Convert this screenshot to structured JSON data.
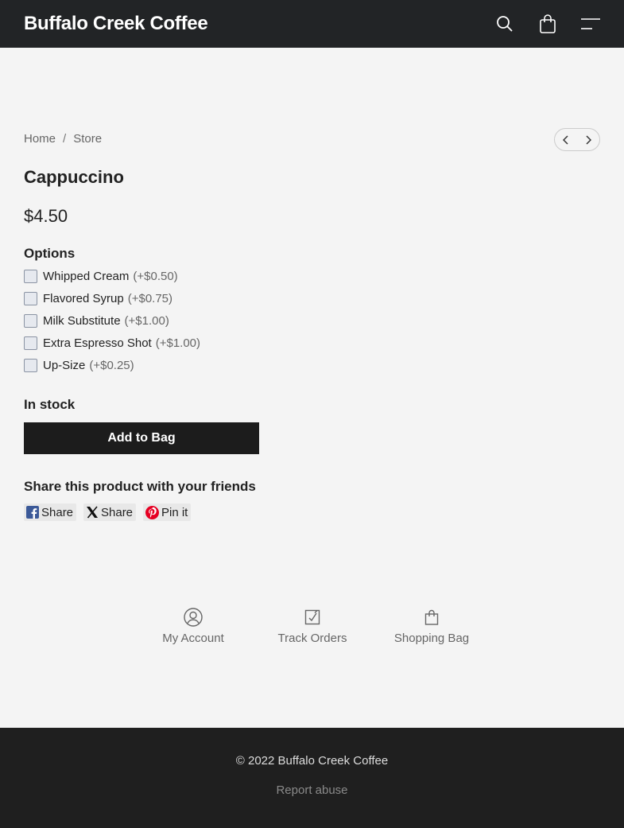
{
  "header": {
    "brand": "Buffalo Creek Coffee",
    "icons": [
      "search-icon",
      "shopping-bag-icon",
      "menu-icon"
    ]
  },
  "breadcrumb": {
    "items": [
      "Home",
      "Store"
    ],
    "separator": "/"
  },
  "product": {
    "title": "Cappuccino",
    "price": "$4.50",
    "options_title": "Options",
    "options": [
      {
        "label": "Whipped Cream",
        "extra": "(+$0.50)",
        "checked": false
      },
      {
        "label": "Flavored Syrup",
        "extra": "(+$0.75)",
        "checked": false
      },
      {
        "label": "Milk Substitute",
        "extra": "(+$1.00)",
        "checked": false
      },
      {
        "label": "Extra Espresso Shot",
        "extra": "(+$1.00)",
        "checked": false
      },
      {
        "label": "Up-Size",
        "extra": "(+$0.25)",
        "checked": false
      }
    ],
    "stock": "In stock",
    "add_label": "Add to Bag"
  },
  "share": {
    "title": "Share this product with your friends",
    "buttons": [
      {
        "icon": "facebook-icon",
        "label": "Share"
      },
      {
        "icon": "x-icon",
        "label": "Share"
      },
      {
        "icon": "pinterest-icon",
        "label": "Pin it"
      }
    ]
  },
  "footer_nav": [
    {
      "icon": "account-icon",
      "label": "My Account"
    },
    {
      "icon": "track-orders-icon",
      "label": "Track Orders"
    },
    {
      "icon": "shopping-bag-icon",
      "label": "Shopping Bag"
    }
  ],
  "footer": {
    "copyright": "© 2022 Buffalo Creek Coffee",
    "report": "Report abuse"
  },
  "colors": {
    "header_bg": "#222426",
    "page_bg": "#f4f4f4",
    "button_bg": "#1c1c1c",
    "footer_bg": "#1f1f1f",
    "facebook": "#3b5998",
    "pinterest": "#e60023"
  }
}
